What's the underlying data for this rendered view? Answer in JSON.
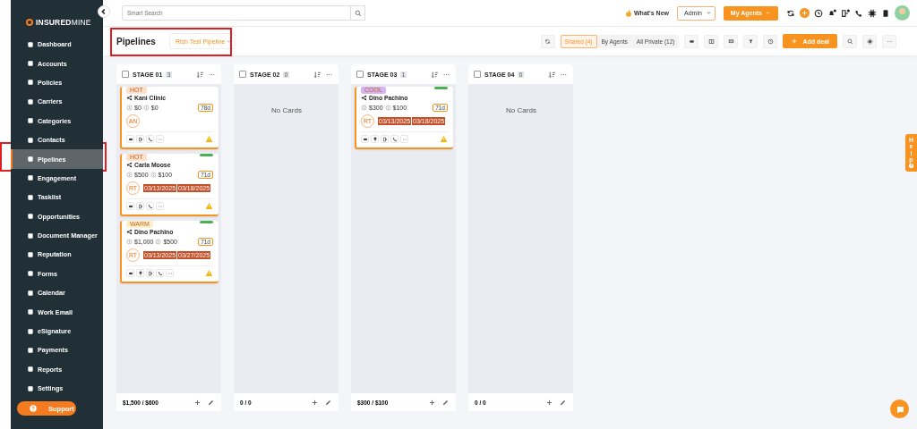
{
  "sidebar": {
    "logo": "**INSURED**MINE",
    "items": [
      {
        "label": "Dashboard",
        "selected": false
      },
      {
        "label": "Accounts",
        "selected": false
      },
      {
        "label": "Policies",
        "selected": false
      },
      {
        "label": "Carriers",
        "selected": false
      },
      {
        "label": "Categories",
        "selected": false
      },
      {
        "label": "Contacts",
        "selected": false
      },
      {
        "label": "Pipelines",
        "selected": true
      },
      {
        "label": "Engagement",
        "selected": false
      },
      {
        "label": "Tasklist",
        "selected": false
      },
      {
        "label": "Opportunities",
        "selected": false
      },
      {
        "label": "Document Manager",
        "selected": false
      },
      {
        "label": "Reputation",
        "selected": false
      },
      {
        "label": "Forms",
        "selected": false
      },
      {
        "label": "Calendar",
        "selected": false
      },
      {
        "label": "Work Email",
        "selected": false
      },
      {
        "label": "eSignature",
        "selected": false
      },
      {
        "label": "Payments",
        "selected": false
      },
      {
        "label": "Reports",
        "selected": false
      },
      {
        "label": "Settings",
        "selected": false
      }
    ],
    "support": "Support"
  },
  "topbar": {
    "search": {
      "placeholder": "Smart Search"
    },
    "whats_new": "What's New",
    "role": "Admin",
    "agents_button": "My Agents"
  },
  "page": {
    "title": "Pipelines",
    "pipeline": "Rish Test Pipeline"
  },
  "toolbar": {
    "views": [
      {
        "label": "Shared (4)",
        "selected": true
      },
      {
        "label": "By Agents",
        "selected": false
      },
      {
        "label": "All Private (12)",
        "selected": false
      }
    ],
    "add_button": "Add deal"
  },
  "stages": [
    {
      "name": "STAGE 01",
      "checked": false,
      "count": "3",
      "total": "$1,500 / $600",
      "cards": [
        {
          "tag": {
            "label": "HOT",
            "color": "#fde0cc"
          },
          "flagged": false,
          "name": "Kani Clinic",
          "value": "$0",
          "recurring": "$0",
          "age": "78d",
          "avatar": "AN",
          "actions": [
            {
              "kind": "eye"
            },
            {
              "kind": "send"
            },
            {
              "kind": "phone"
            },
            {
              "kind": "more"
            }
          ],
          "warning": true
        },
        {
          "tag": {
            "label": "HOT",
            "color": "#fde0cc"
          },
          "flagged": true,
          "name": "Carla Moose",
          "value": "$500",
          "recurring": "$100",
          "age": "71d",
          "avatar": "RT",
          "dates": [
            "03/13/2025",
            "03/18/2025"
          ],
          "actions": [
            {
              "kind": "eye"
            },
            {
              "kind": "send"
            },
            {
              "kind": "phone"
            },
            {
              "kind": "more"
            }
          ],
          "warning": true
        },
        {
          "tag": {
            "label": "WARM",
            "color": "#fdf0c8"
          },
          "flagged": true,
          "name": "Dino Pachino",
          "value": "$1,000",
          "recurring": "$500",
          "age": "71d",
          "avatar": "RT",
          "dates": [
            "03/13/2025",
            "03/27/2025"
          ],
          "actions": [
            {
              "kind": "eye"
            },
            {
              "kind": "pin"
            },
            {
              "kind": "send"
            },
            {
              "kind": "phone"
            },
            {
              "kind": "more"
            }
          ],
          "warning": true
        }
      ]
    },
    {
      "name": "STAGE 02",
      "checked": false,
      "count": "0",
      "total": "0 / 0",
      "empty": "No Cards"
    },
    {
      "name": "STAGE 03",
      "checked": false,
      "count": "1",
      "total": "$300 / $100",
      "cards": [
        {
          "tag": {
            "label": "COOL",
            "color": "#d3b4f5"
          },
          "flagged": true,
          "name": "Dino Pachino",
          "value": "$300",
          "recurring": "$100",
          "age": "71d",
          "avatar": "RT",
          "dates": [
            "03/13/2025",
            "03/18/2025"
          ],
          "actions": [
            {
              "kind": "eye"
            },
            {
              "kind": "pin"
            },
            {
              "kind": "send"
            },
            {
              "kind": "phone"
            },
            {
              "kind": "more"
            }
          ],
          "warning": true
        }
      ]
    },
    {
      "name": "STAGE 04",
      "checked": false,
      "count": "0",
      "total": "0 / 0",
      "empty": "No Cards"
    }
  ],
  "help": "Help"
}
